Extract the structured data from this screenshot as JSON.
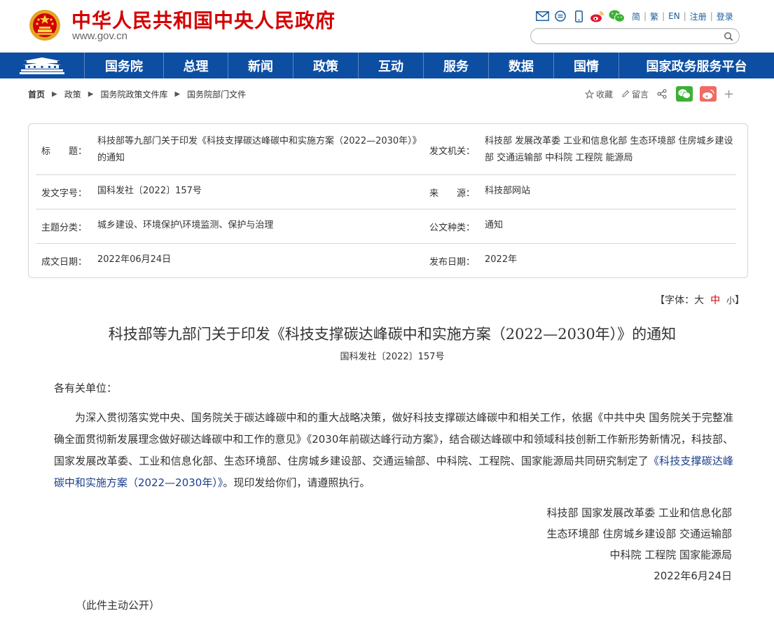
{
  "header": {
    "site_title": "中华人民共和国中央人民政府",
    "site_url": "www.gov.cn",
    "icons": [
      "mail-icon",
      "chat-bubble-icon",
      "mobile-icon",
      "weibo-icon",
      "wechat-icon"
    ],
    "lang_links": [
      "简",
      "繁",
      "EN",
      "注册",
      "登录"
    ],
    "search": {
      "value": "",
      "placeholder": ""
    }
  },
  "nav": {
    "items": [
      "国务院",
      "总理",
      "新闻",
      "政策",
      "互动",
      "服务",
      "数据",
      "国情",
      "国家政务服务平台"
    ]
  },
  "breadcrumb": [
    "首页",
    "政策",
    "国务院政策文件库",
    "国务院部门文件"
  ],
  "share_tools": {
    "favorite": "收藏",
    "comment": "留言"
  },
  "info": {
    "title_label": "标　　题：",
    "title_value": "科技部等九部门关于印发《科技支撑碳达峰碳中和实施方案（2022—2030年）》的通知",
    "issuer_label": "发文机关：",
    "issuer_value": "科技部 发展改革委 工业和信息化部 生态环境部 住房城乡建设部 交通运输部 中科院 工程院 能源局",
    "docno_label": "发文字号：",
    "docno_value": "国科发社〔2022〕157号",
    "source_label": "来　　源：",
    "source_value": "科技部网站",
    "topic_label": "主题分类：",
    "topic_value": "城乡建设、环境保护\\环境监测、保护与治理",
    "type_label": "公文种类：",
    "type_value": "通知",
    "date_label": "成文日期：",
    "date_value": "2022年06月24日",
    "pub_label": "发布日期：",
    "pub_value": "2022年"
  },
  "font_ctrl": {
    "prefix": "【字体：",
    "large": "大",
    "medium": "中",
    "small": "小",
    "suffix": "】"
  },
  "article": {
    "title": "科技部等九部门关于印发《科技支撑碳达峰碳中和实施方案（2022—2030年）》的通知",
    "doc_number": "国科发社〔2022〕157号",
    "salutation": "各有关单位：",
    "para_text": "为深入贯彻落实党中央、国务院关于碳达峰碳中和的重大战略决策，做好科技支撑碳达峰碳中和相关工作，依据《中共中央 国务院关于完整准确全面贯彻新发展理念做好碳达峰碳中和工作的意见》《2030年前碳达峰行动方案》，结合碳达峰碳中和领域科技创新工作新形势新情况，科技部、国家发展改革委、工业和信息化部、生态环境部、住房城乡建设部、交通运输部、中科院、工程院、国家能源局共同研究制定了",
    "para_link": "《科技支撑碳达峰碳中和实施方案（2022—2030年）》",
    "para_end": "。现印发给你们，请遵照执行。",
    "signature": [
      "科技部 国家发展改革委 工业和信息化部",
      "生态环境部 住房城乡建设部 交通运输部",
      "中科院 工程院 国家能源局",
      "2022年6月24日"
    ],
    "public_note": "（此件主动公开）"
  }
}
